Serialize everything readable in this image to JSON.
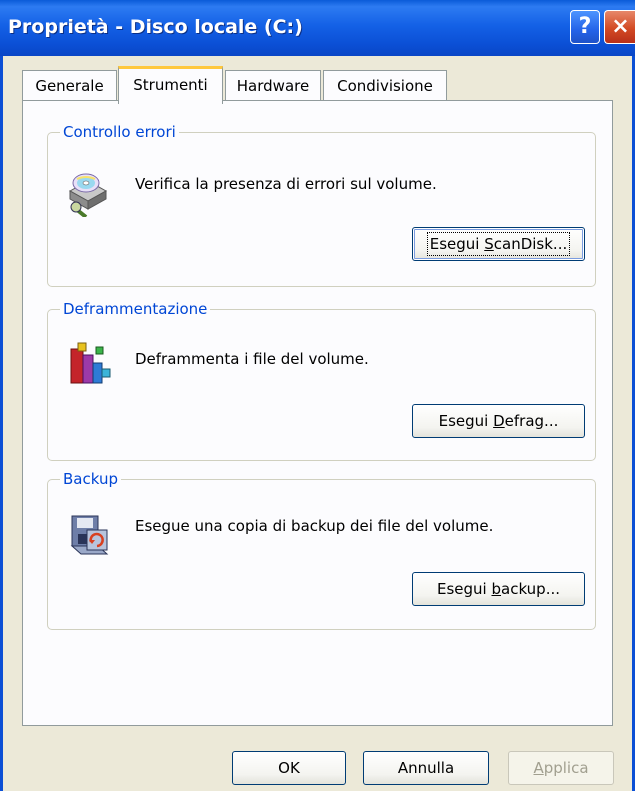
{
  "window": {
    "title": "Proprietà - Disco locale (C:)",
    "help_button": "?",
    "close_button": "×"
  },
  "tabs": [
    {
      "label": "Generale",
      "active": false
    },
    {
      "label": "Strumenti",
      "active": true
    },
    {
      "label": "Hardware",
      "active": false
    },
    {
      "label": "Condivisione",
      "active": false
    }
  ],
  "groups": {
    "error_check": {
      "legend": "Controllo errori",
      "text": "Verifica la presenza di errori sul volume.",
      "button_pre": "Esegui ",
      "button_key": "S",
      "button_post": "canDisk...",
      "icon": "scandisk-icon"
    },
    "defrag": {
      "legend": "Deframmentazione",
      "text": "Deframmenta i file del volume.",
      "button_pre": "Esegui ",
      "button_key": "D",
      "button_post": "efrag...",
      "icon": "defrag-icon"
    },
    "backup": {
      "legend": "Backup",
      "text": "Esegue una copia di backup dei file del volume.",
      "button_pre": "Esegui ",
      "button_key": "b",
      "button_post": "ackup...",
      "icon": "backup-icon"
    }
  },
  "footer": {
    "ok": "OK",
    "cancel": "Annulla",
    "apply_key": "A",
    "apply_post": "pplica",
    "apply_enabled": false
  },
  "colors": {
    "title_bar": "#0A5BD8",
    "group_legend": "#0046D5",
    "active_tab_accent": "#FFC83C",
    "dialog_bg": "#ECE9D8"
  }
}
